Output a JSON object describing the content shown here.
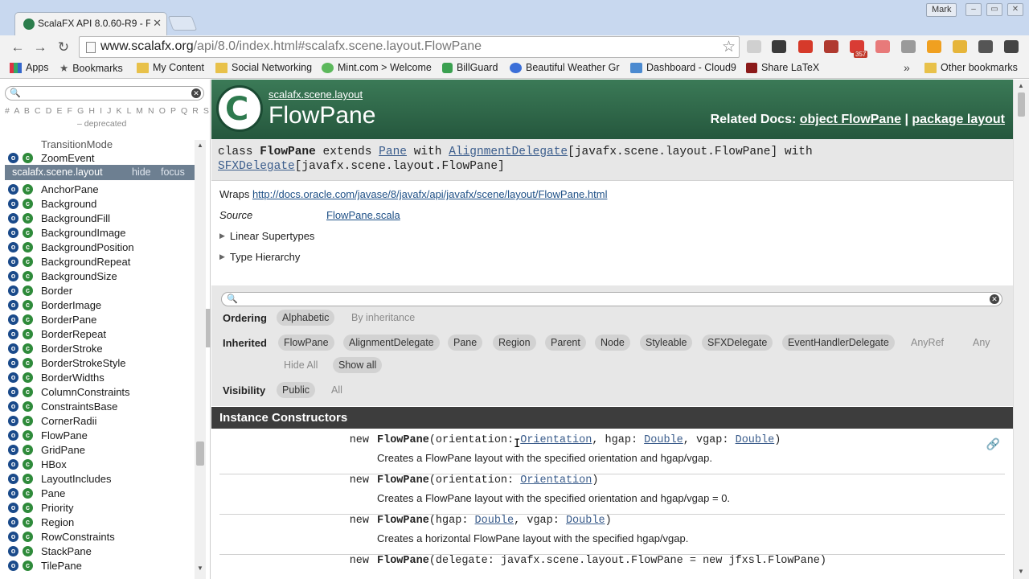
{
  "browser": {
    "tab_title": "ScalaFX API 8.0.60-R9 - F",
    "profile_name": "Mark",
    "url_host": "www.scalafx.org",
    "url_path": "/api/8.0/index.html#scalafx.scene.layout.FlowPane",
    "extension_badge": "357",
    "bookmarks": [
      {
        "label": "Apps",
        "icon": "apps-grid-icon"
      },
      {
        "label": "Bookmarks",
        "icon": "star-icon"
      },
      {
        "label": "My Content",
        "icon": "folder-icon"
      },
      {
        "label": "Social Networking",
        "icon": "folder-icon"
      },
      {
        "label": "Mint.com > Welcome",
        "icon": "mint-leaf-icon"
      },
      {
        "label": "BillGuard",
        "icon": "billguard-icon"
      },
      {
        "label": "Beautiful Weather Gr",
        "icon": "weather-icon"
      },
      {
        "label": "Dashboard - Cloud9",
        "icon": "cloud9-icon"
      },
      {
        "label": "Share LaTeX",
        "icon": "sharelatex-icon"
      }
    ],
    "more_label": "»",
    "other_bookmarks": "Other bookmarks"
  },
  "index": {
    "letters": "# A B C D E F G H I J K L M N O P Q R S T U V W X Y Z",
    "deprecated": "– deprecated",
    "partial_item": "TransitionMode",
    "items_top": [
      "ZoomEvent"
    ],
    "package": {
      "name": "scalafx.scene.layout",
      "hide": "hide",
      "focus": "focus"
    },
    "items": [
      {
        "name": "AnchorPane",
        "object": true
      },
      {
        "name": "Background",
        "object": true
      },
      {
        "name": "BackgroundFill",
        "object": true
      },
      {
        "name": "BackgroundImage",
        "object": true
      },
      {
        "name": "BackgroundPosition",
        "object": true
      },
      {
        "name": "BackgroundRepeat",
        "object": true
      },
      {
        "name": "BackgroundSize",
        "object": true
      },
      {
        "name": "Border",
        "object": true
      },
      {
        "name": "BorderImage",
        "object": true
      },
      {
        "name": "BorderPane",
        "object": true
      },
      {
        "name": "BorderRepeat",
        "object": true
      },
      {
        "name": "BorderStroke",
        "object": true
      },
      {
        "name": "BorderStrokeStyle",
        "object": true
      },
      {
        "name": "BorderWidths",
        "object": true
      },
      {
        "name": "ColumnConstraints",
        "object": true
      },
      {
        "name": "ConstraintsBase",
        "object": true
      },
      {
        "name": "CornerRadii",
        "object": true
      },
      {
        "name": "FlowPane",
        "object": true
      },
      {
        "name": "GridPane",
        "object": true
      },
      {
        "name": "HBox",
        "object": true
      },
      {
        "name": "LayoutIncludes",
        "object": true
      },
      {
        "name": "Pane",
        "object": true
      },
      {
        "name": "Priority",
        "object": true
      },
      {
        "name": "Region",
        "object": true
      },
      {
        "name": "RowConstraints",
        "object": true
      },
      {
        "name": "StackPane",
        "object": true
      },
      {
        "name": "TilePane",
        "object": true
      }
    ]
  },
  "doc": {
    "breadcrumb": "scalafx.scene.layout",
    "title": "FlowPane",
    "related_label": "Related Docs:",
    "related_object": "object FlowPane",
    "related_sep": "|",
    "related_package": "package layout",
    "signature": {
      "kw_class": "class",
      "name": "FlowPane",
      "kw_extends": "extends",
      "parent": "Pane",
      "kw_with1": "with",
      "trait1": "AlignmentDelegate",
      "trait1_arg": "[javafx.scene.layout.FlowPane]",
      "kw_with2": "with",
      "trait2": "SFXDelegate",
      "trait2_arg": "[javafx.scene.layout.FlowPane]"
    },
    "wraps_label": "Wraps",
    "wraps_url": "http://docs.oracle.com/javase/8/javafx/api/javafx/scene/layout/FlowPane.html",
    "source_label": "Source",
    "source_file": "FlowPane.scala",
    "linear_supertypes": "Linear Supertypes",
    "type_hierarchy": "Type Hierarchy"
  },
  "filters": {
    "ordering_label": "Ordering",
    "ordering": [
      {
        "label": "Alphabetic",
        "selected": true
      },
      {
        "label": "By inheritance",
        "selected": false
      }
    ],
    "inherited_label": "Inherited",
    "inherited": [
      {
        "label": "FlowPane",
        "selected": true
      },
      {
        "label": "AlignmentDelegate",
        "selected": true
      },
      {
        "label": "Pane",
        "selected": true
      },
      {
        "label": "Region",
        "selected": true
      },
      {
        "label": "Parent",
        "selected": true
      },
      {
        "label": "Node",
        "selected": true
      },
      {
        "label": "Styleable",
        "selected": true
      },
      {
        "label": "SFXDelegate",
        "selected": true
      },
      {
        "label": "EventHandlerDelegate",
        "selected": true
      },
      {
        "label": "AnyRef",
        "selected": false
      },
      {
        "label": "Any",
        "selected": false
      }
    ],
    "hide_all": "Hide All",
    "show_all": "Show all",
    "visibility_label": "Visibility",
    "visibility": [
      {
        "label": "Public",
        "selected": true
      },
      {
        "label": "All",
        "selected": false
      }
    ]
  },
  "constructors": {
    "section_title": "Instance Constructors",
    "items": [
      {
        "kw": "new",
        "name": "FlowPane",
        "params_html": "(orientation: <span class=\"lnk\">Orientation</span>, hgap: <span class=\"lnk\">Double</span>, vgap: <span class=\"lnk\">Double</span>)",
        "desc": "Creates a FlowPane layout with the specified orientation and hgap/vgap."
      },
      {
        "kw": "new",
        "name": "FlowPane",
        "params_html": "(orientation: <span class=\"lnk\">Orientation</span>)",
        "desc": "Creates a FlowPane layout with the specified orientation and hgap/vgap = 0."
      },
      {
        "kw": "new",
        "name": "FlowPane",
        "params_html": "(hgap: <span class=\"lnk\">Double</span>, vgap: <span class=\"lnk\">Double</span>)",
        "desc": "Creates a horizontal FlowPane layout with the specified hgap/vgap."
      },
      {
        "kw": "new",
        "name": "FlowPane",
        "params_html": "(delegate: javafx.scene.layout.FlowPane = new jfxsl.FlowPane)",
        "desc": ""
      }
    ]
  }
}
